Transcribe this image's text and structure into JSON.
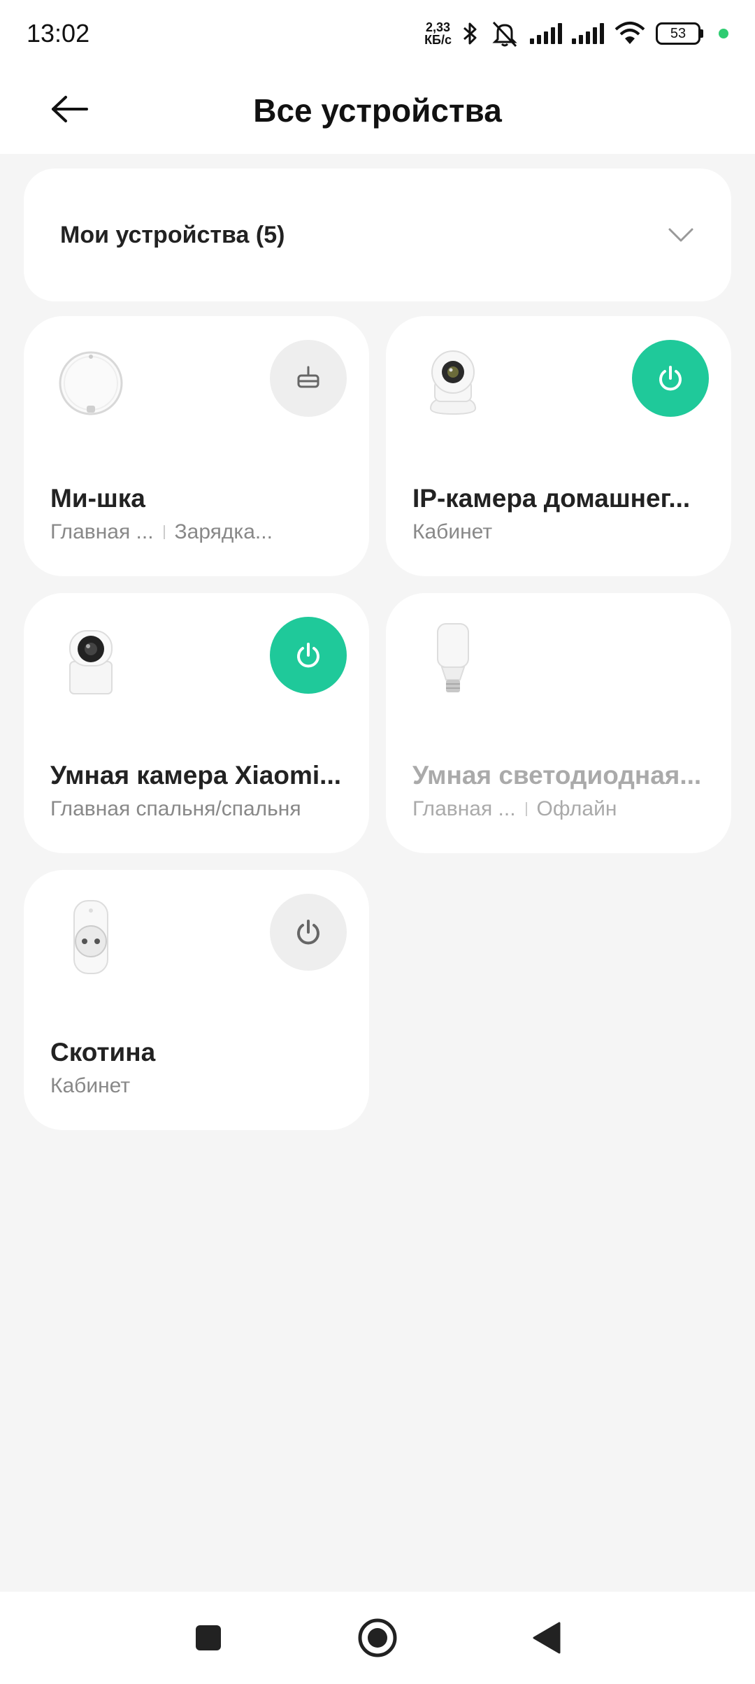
{
  "status_bar": {
    "time": "13:02",
    "net_speed_value": "2,33",
    "net_speed_unit": "КБ/с",
    "battery": "53",
    "icons": [
      "bluetooth-icon",
      "bell-muted-icon",
      "signal-icon",
      "signal-icon",
      "wifi-icon"
    ]
  },
  "header": {
    "title": "Все устройства",
    "back_icon": "arrow-left-icon"
  },
  "filter": {
    "label": "Мои устройства (5)",
    "icon": "chevron-down-icon"
  },
  "devices": [
    {
      "name": "Ми-шка",
      "room": "Главная ...",
      "status": "Зарядка...",
      "image": "robot-vacuum",
      "button": "broom-icon",
      "button_on": false,
      "offline": false
    },
    {
      "name": "IP-камера домашнег...",
      "room": "Кабинет",
      "status": "",
      "image": "ptz-camera",
      "button": "power-icon",
      "button_on": true,
      "offline": false
    },
    {
      "name": "Умная камера Xiaomi...",
      "room": "Главная спальня/спальня",
      "status": "",
      "image": "home-camera",
      "button": "power-icon",
      "button_on": true,
      "offline": false
    },
    {
      "name": "Умная светодиодная...",
      "room": "Главная ...",
      "status": "Офлайн",
      "image": "led-bulb",
      "button": "",
      "button_on": false,
      "offline": true
    },
    {
      "name": "Скотина",
      "room": "Кабинет",
      "status": "",
      "image": "smart-plug",
      "button": "power-icon",
      "button_on": false,
      "offline": false
    }
  ],
  "colors": {
    "accent": "#1fc99a",
    "background": "#f5f5f5",
    "card": "#ffffff",
    "muted_text": "#888888"
  },
  "navbar": {
    "icons": [
      "recent-apps-icon",
      "home-icon",
      "back-icon"
    ]
  }
}
